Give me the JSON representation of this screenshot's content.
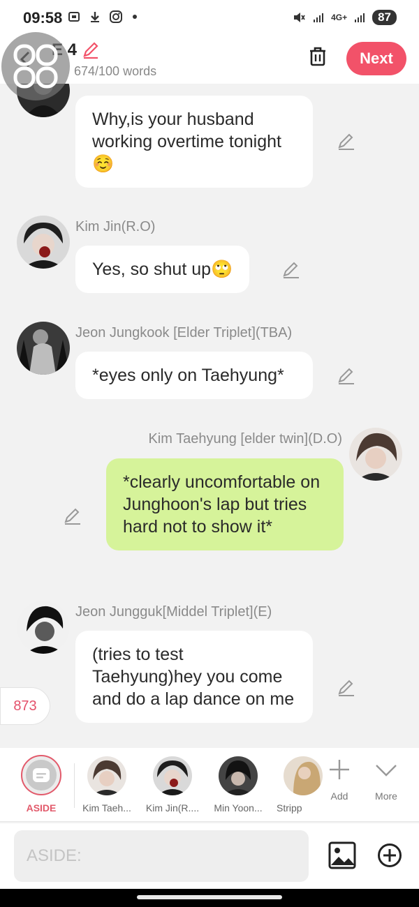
{
  "status_bar": {
    "time": "09:58",
    "battery": "87",
    "network": "4G+"
  },
  "header": {
    "title": "E 4",
    "word_count": "674/100 words",
    "next_label": "Next"
  },
  "messages": [
    {
      "speaker": "",
      "text": "Why,is your husband working overtime tonight ☺️"
    },
    {
      "speaker": "Kim Jin(R.O)",
      "text": "Yes, so shut up🙄"
    },
    {
      "speaker": "Jeon Jungkook [Elder Triplet](TBA)",
      "text": "*eyes only on Taehyung*"
    },
    {
      "speaker": "Kim Taehyung [elder twin](D.O)",
      "text": "*clearly uncomfortable on  Junghoon's lap but tries hard not to show it*"
    },
    {
      "speaker": "Jeon Jungguk[Middel Triplet](E)",
      "text": "(tries to test Taehyung)hey you come and do a lap dance on me"
    }
  ],
  "counter": "873",
  "char_bar": {
    "aside_label": "ASIDE",
    "characters": [
      "Kim Taeh...",
      "Kim Jin(R....",
      "Min Yoon...",
      "Stripp"
    ],
    "add_label": "Add",
    "more_label": "More"
  },
  "input": {
    "placeholder": "ASIDE:"
  },
  "colors": {
    "accent": "#f25269",
    "my_bubble": "#d6f39a",
    "background": "#f2f2f2"
  }
}
